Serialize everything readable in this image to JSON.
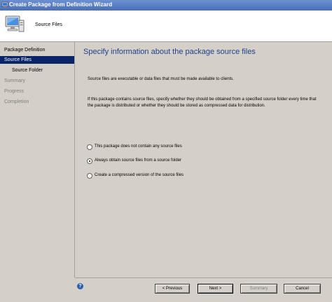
{
  "window": {
    "title": "Create Package from Definition Wizard"
  },
  "header": {
    "title": "Source Files"
  },
  "nav": {
    "items": [
      {
        "label": "Package Definition",
        "state": "normal",
        "sub": false
      },
      {
        "label": "Source Files",
        "state": "active",
        "sub": false
      },
      {
        "label": "Source Folder",
        "state": "normal",
        "sub": true
      },
      {
        "label": "Summary",
        "state": "disabled",
        "sub": false
      },
      {
        "label": "Progress",
        "state": "disabled",
        "sub": false
      },
      {
        "label": "Completion",
        "state": "disabled",
        "sub": false
      }
    ]
  },
  "main": {
    "title": "Specify information about the package source files",
    "description": "Source files are executable or data files that must be made available to clients.",
    "description2": "If this package contains source files, specify whether they should be obtained from a specified source folder every time that the package is distributed or whether they should be stored as compressed data for distribution.",
    "options": [
      {
        "label": "This package does not contain any source files",
        "selected": false
      },
      {
        "label": "Always obtain source files from a source folder",
        "selected": true
      },
      {
        "label": "Create a compressed version of the source files",
        "selected": false
      }
    ]
  },
  "footer": {
    "help_glyph": "?",
    "previous_label": "< Previous",
    "next_label": "Next >",
    "summary_label": "Summary",
    "cancel_label": "Cancel"
  },
  "colors": {
    "nav_active_bg": "#0a246a",
    "title_color": "#1f3f8f",
    "face": "#d4d0c8"
  }
}
